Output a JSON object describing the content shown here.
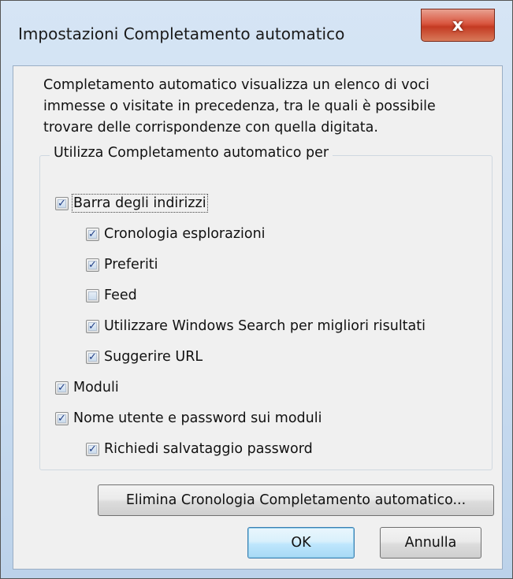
{
  "window": {
    "title": "Impostazioni Completamento automatico",
    "close_label": "x"
  },
  "description": "Completamento automatico visualizza un elenco di voci immesse o visitate in precedenza, tra le quali è possibile trovare delle corrispondenze con quella digitata.",
  "group": {
    "label": "Utilizza Completamento automatico per"
  },
  "options": [
    {
      "id": "barra",
      "label": "Barra degli indirizzi",
      "checked": true,
      "level": 0
    },
    {
      "id": "cronologia",
      "label": "Cronologia esplorazioni",
      "checked": true,
      "level": 1
    },
    {
      "id": "preferiti",
      "label": "Preferiti",
      "checked": true,
      "level": 1
    },
    {
      "id": "feed",
      "label": "Feed",
      "checked": false,
      "level": 1
    },
    {
      "id": "windows-search",
      "label": "Utilizzare Windows Search per migliori risultati",
      "checked": true,
      "level": 1
    },
    {
      "id": "suggerire-url",
      "label": "Suggerire URL",
      "checked": true,
      "level": 1
    },
    {
      "id": "moduli",
      "label": "Moduli",
      "checked": true,
      "level": 0
    },
    {
      "id": "nome-utente",
      "label": "Nome utente e password sui moduli",
      "checked": true,
      "level": 0
    },
    {
      "id": "salvataggio",
      "label": "Richiedi salvataggio password",
      "checked": true,
      "level": 1
    }
  ],
  "buttons": {
    "delete_history": "Elimina Cronologia Completamento automatico...",
    "ok": "OK",
    "cancel": "Annulla"
  }
}
